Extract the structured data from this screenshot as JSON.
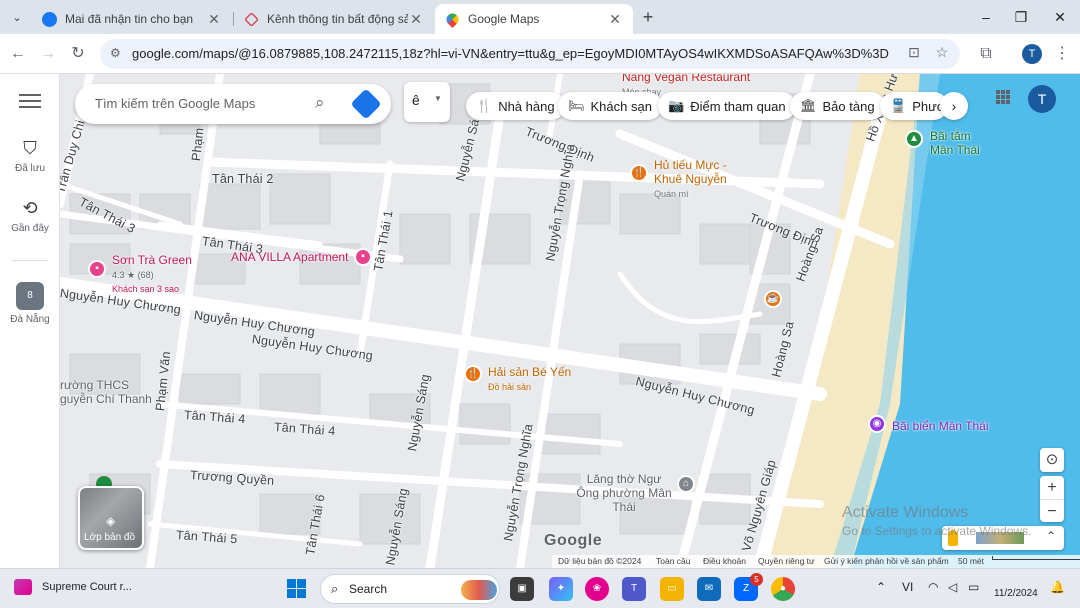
{
  "browser": {
    "tab_search_icon": "chevron-down-icon",
    "tabs": [
      {
        "title": "Mai đã nhận tin cho bạn",
        "icon": "facebook-icon",
        "active": false
      },
      {
        "title": "Kênh thông tin bất động sản - I",
        "icon": "house-icon",
        "active": false
      },
      {
        "title": "Google Maps",
        "icon": "maps-pin-icon",
        "active": true
      }
    ],
    "new_tab_label": "+",
    "window_controls": [
      "–",
      "❐",
      "✕"
    ],
    "url": "google.com/maps/@16.0879885,108.2472115,18z?hl=vi-VN&entry=ttu&g_ep=EgoyMDI0MTAyOS4wIKXMDSoASAFQAw%3D%3D",
    "profile_initial": "T"
  },
  "rail": {
    "items": [
      {
        "label": "Đã lưu",
        "icon": "bookmark-icon"
      },
      {
        "label": "Gần đây",
        "icon": "history-icon"
      },
      {
        "label": "Đà Nẵng",
        "icon": "place-thumbnail",
        "badge": "8"
      }
    ]
  },
  "search": {
    "placeholder": "Tìm kiếm trên Google Maps",
    "lang_label": "ê"
  },
  "chips": [
    {
      "label": "Nhà hàng",
      "icon": "restaurant-icon",
      "glyph": "🍴"
    },
    {
      "label": "Khách sạn",
      "icon": "hotel-icon",
      "glyph": "🛏"
    },
    {
      "label": "Điểm tham quan",
      "icon": "camera-icon",
      "glyph": "📷"
    },
    {
      "label": "Bảo tàng",
      "icon": "museum-icon",
      "glyph": "🏛"
    },
    {
      "label": "Phươn",
      "icon": "transit-icon",
      "glyph": "🚆"
    }
  ],
  "map_avatar_initial": "T",
  "streets": [
    "Tân Thái 2",
    "Tân Thái 3",
    "Tân Thái 3",
    "Tân Thái 1",
    "Nguyễn Huy Chương",
    "Nguyễn Huy Chương",
    "Nguyễn Huy Chương",
    "Nguyễn Huy Chương",
    "Nguyễn Sáng",
    "Nguyễn Sáng",
    "Nguyễn Sáng",
    "Trương Định",
    "Trương Định",
    "Hoàng Sa",
    "Hoàng Sa",
    "Hồ Xuân Hương",
    "Tân Thái 4",
    "Tân Thái 4",
    "Tân Thái 5",
    "Tân Thái 6",
    "Trương Quyền",
    "Nguyễn Trọng Nghĩa",
    "Nguyễn Trọng Nghĩa",
    "Phạm Văn",
    "Phạm Văn",
    "Trần Duy Chi",
    "Võ Nguyên Giáp",
    "Sơn Trà Green"
  ],
  "pois": {
    "vegan": {
      "name": "Nàng Vegan Restaurant",
      "sub": "Món chay"
    },
    "hutieu": {
      "name": "Hủ tiếu Mực - Khuê Nguyễn",
      "sub": "Quán mì"
    },
    "sontra": {
      "name": "Sơn Trà Green",
      "rating": "4.3 ★ (68)",
      "sub": "Khách sạn 3 sao"
    },
    "ana": {
      "name": "ANA VILLA Apartment"
    },
    "haisan": {
      "name": "Hải sản Bé Yến",
      "sub": "Đồ hải sản"
    },
    "baitam": {
      "name": "Bãi tắm Mân Thái"
    },
    "baibien": {
      "name": "Bãi biển Mân Thái"
    },
    "langtho": {
      "name": "Lăng thờ Ngư Ông phường Mân Thái"
    },
    "school": {
      "name": "rường THCS guyễn Chí Thanh"
    }
  },
  "layers_label": "Lớp bản đồ",
  "watermark": {
    "line1": "Activate Windows",
    "line2": "Go to Settings to activate Windows."
  },
  "google_logo": "Google",
  "footer": {
    "data": "Dữ liệu bản đồ ©2024",
    "global": "Toàn cầu",
    "terms": "Điều khoản",
    "privacy": "Quyền riêng tư",
    "feedback": "Gửi ý kiến phản hồi về sản phẩm",
    "scale": "50 mét"
  },
  "taskbar": {
    "app_label": "Supreme Court r...",
    "search_label": "Search",
    "zalo_badge": "5",
    "date": "11/2/2024",
    "tray_lang": "VI"
  },
  "colors": {
    "accent": "#1a73e8",
    "poi_food": "#e8710a",
    "poi_hotel": "#e8428a",
    "poi_leisure": "#9334e6",
    "poi_park": "#1e8e3e",
    "sea": "#44b7e9",
    "sand": "#f5e8c4"
  }
}
